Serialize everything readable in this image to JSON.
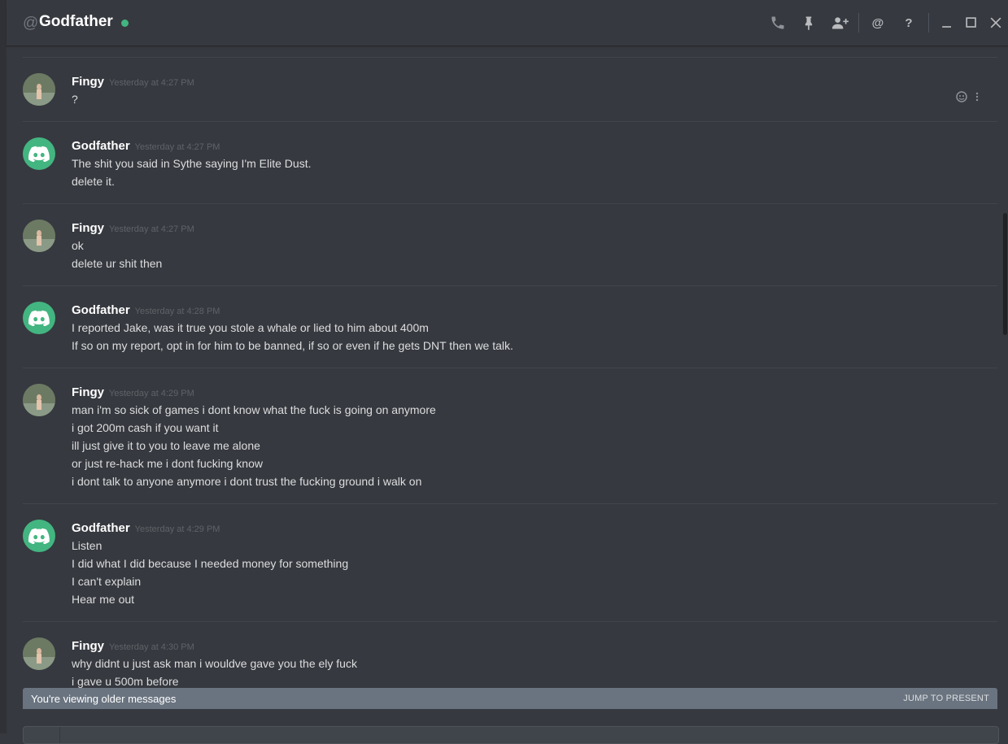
{
  "header": {
    "at_symbol": "@",
    "title": "Godfather",
    "status_color": "#43b581",
    "icons": [
      "phone-icon",
      "pin-icon",
      "add-friend-icon",
      "mention-icon",
      "help-icon",
      "minimize-icon",
      "maximize-icon",
      "close-icon"
    ]
  },
  "messages": [
    {
      "author": "Fingy",
      "timestamp": "Yesterday at 4:27 PM",
      "avatar": "photo",
      "lines": [
        "?"
      ]
    },
    {
      "author": "Godfather",
      "timestamp": "Yesterday at 4:27 PM",
      "avatar": "discord",
      "lines": [
        "The shit you said in Sythe saying I'm Elite Dust.",
        "delete it."
      ]
    },
    {
      "author": "Fingy",
      "timestamp": "Yesterday at 4:27 PM",
      "avatar": "photo",
      "lines": [
        "ok",
        "delete ur shit then"
      ]
    },
    {
      "author": "Godfather",
      "timestamp": "Yesterday at 4:28 PM",
      "avatar": "discord",
      "lines": [
        "I reported Jake, was it true you stole a whale or lied to him about 400m",
        "If so on my report, opt in for him to be banned, if so or even if he gets DNT then we talk."
      ]
    },
    {
      "author": "Fingy",
      "timestamp": "Yesterday at 4:29 PM",
      "avatar": "photo",
      "lines": [
        "man i'm so sick of games i dont know what the fuck is going on anymore",
        "i got 200m cash if you want it",
        "ill just give it to you to leave me alone",
        "or just re-hack me i dont fucking know",
        "i dont talk to anyone anymore i dont trust the fucking ground i walk on"
      ]
    },
    {
      "author": "Godfather",
      "timestamp": "Yesterday at 4:29 PM",
      "avatar": "discord",
      "lines": [
        "Listen",
        "I did what I did because I needed money for something",
        "I can't explain",
        "Hear me out"
      ]
    },
    {
      "author": "Fingy",
      "timestamp": "Yesterday at 4:30 PM",
      "avatar": "photo",
      "lines": [
        "why didnt u just ask man i wouldve gave you the ely fuck",
        "i gave u 500m before"
      ]
    }
  ],
  "older_bar": {
    "label": "You're viewing older messages",
    "jump_label": "JUMP TO PRESENT"
  }
}
